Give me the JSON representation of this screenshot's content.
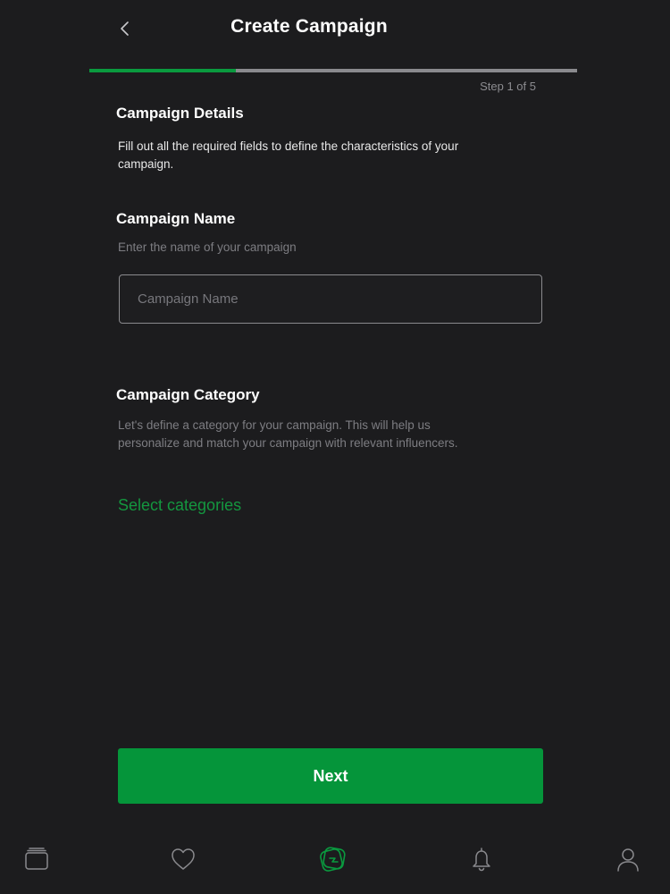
{
  "header": {
    "title": "Create Campaign",
    "back_icon": "chevron-left-icon"
  },
  "progress": {
    "step_label": "Step 1 of 5",
    "fraction": 0.3,
    "fill_color": "#0a9a3f",
    "track_color": "#8a8a8e"
  },
  "details": {
    "title": "Campaign Details",
    "description": "Fill out all the required fields to define the characteristics of your campaign."
  },
  "campaign_name": {
    "title": "Campaign Name",
    "hint": "Enter the name of your campaign",
    "placeholder": "Campaign Name",
    "value": ""
  },
  "campaign_category": {
    "title": "Campaign Category",
    "description": "Let's define a category for your campaign. This will help us personalize and match your campaign with relevant influencers.",
    "select_label": "Select categories"
  },
  "next_button": {
    "label": "Next",
    "color": "#05953a"
  },
  "tabbar": {
    "items": [
      {
        "icon": "cards-icon",
        "active": false
      },
      {
        "icon": "heart-icon",
        "active": false
      },
      {
        "icon": "campaign-icon",
        "active": true
      },
      {
        "icon": "bell-icon",
        "active": false
      },
      {
        "icon": "user-icon",
        "active": false
      }
    ],
    "active_color": "#0a9a3f",
    "inactive_color": "#8a8a8e"
  }
}
